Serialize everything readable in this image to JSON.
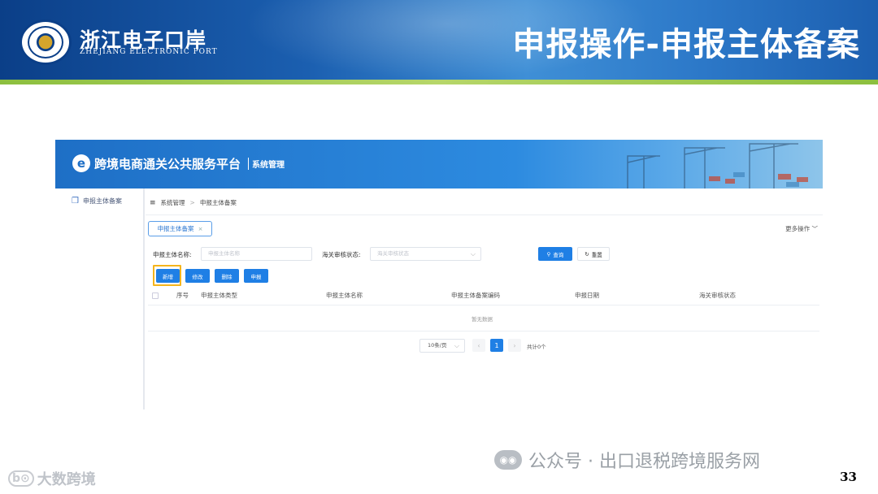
{
  "slide": {
    "title": "申报操作-申报主体备案",
    "logo_cn": "浙江电子口岸",
    "logo_en": "ZHEJIANG ELECTRONIC PORT",
    "page_number": "33"
  },
  "app": {
    "logo_letter": "e",
    "title": "跨境电商通关公共服务平台",
    "subtitle": "系统管理",
    "sidebar": {
      "items": [
        {
          "label": "申报主体备案",
          "icon": "layers-icon"
        }
      ]
    },
    "breadcrumb": {
      "items": [
        "系统管理",
        "申报主体备案"
      ],
      "separator": ">"
    },
    "tab": {
      "label": "申报主体备案"
    },
    "more_ops": "更多操作",
    "search": {
      "name_label": "申报主体名称:",
      "name_placeholder": "申报主体名称",
      "status_label": "海关审核状态:",
      "status_placeholder": "海关审核状态",
      "query_label": "查询",
      "reset_label": "重置"
    },
    "actions": {
      "add": "新增",
      "edit": "修改",
      "delete": "删除",
      "declare": "申报"
    },
    "table": {
      "columns": [
        "序号",
        "申报主体类型",
        "申报主体名称",
        "申报主体备案编码",
        "申报日期",
        "海关审核状态"
      ],
      "rows": [],
      "empty_text": "暂无数据"
    },
    "pagination": {
      "page_size": "10条/页",
      "current_page": "1",
      "total": "共计0个"
    },
    "colors": {
      "primary": "#1f7fe5",
      "highlight": "#f5b51c"
    }
  },
  "watermarks": {
    "left": "大数跨境",
    "right": "公众号 · 出口退税跨境服务网"
  }
}
